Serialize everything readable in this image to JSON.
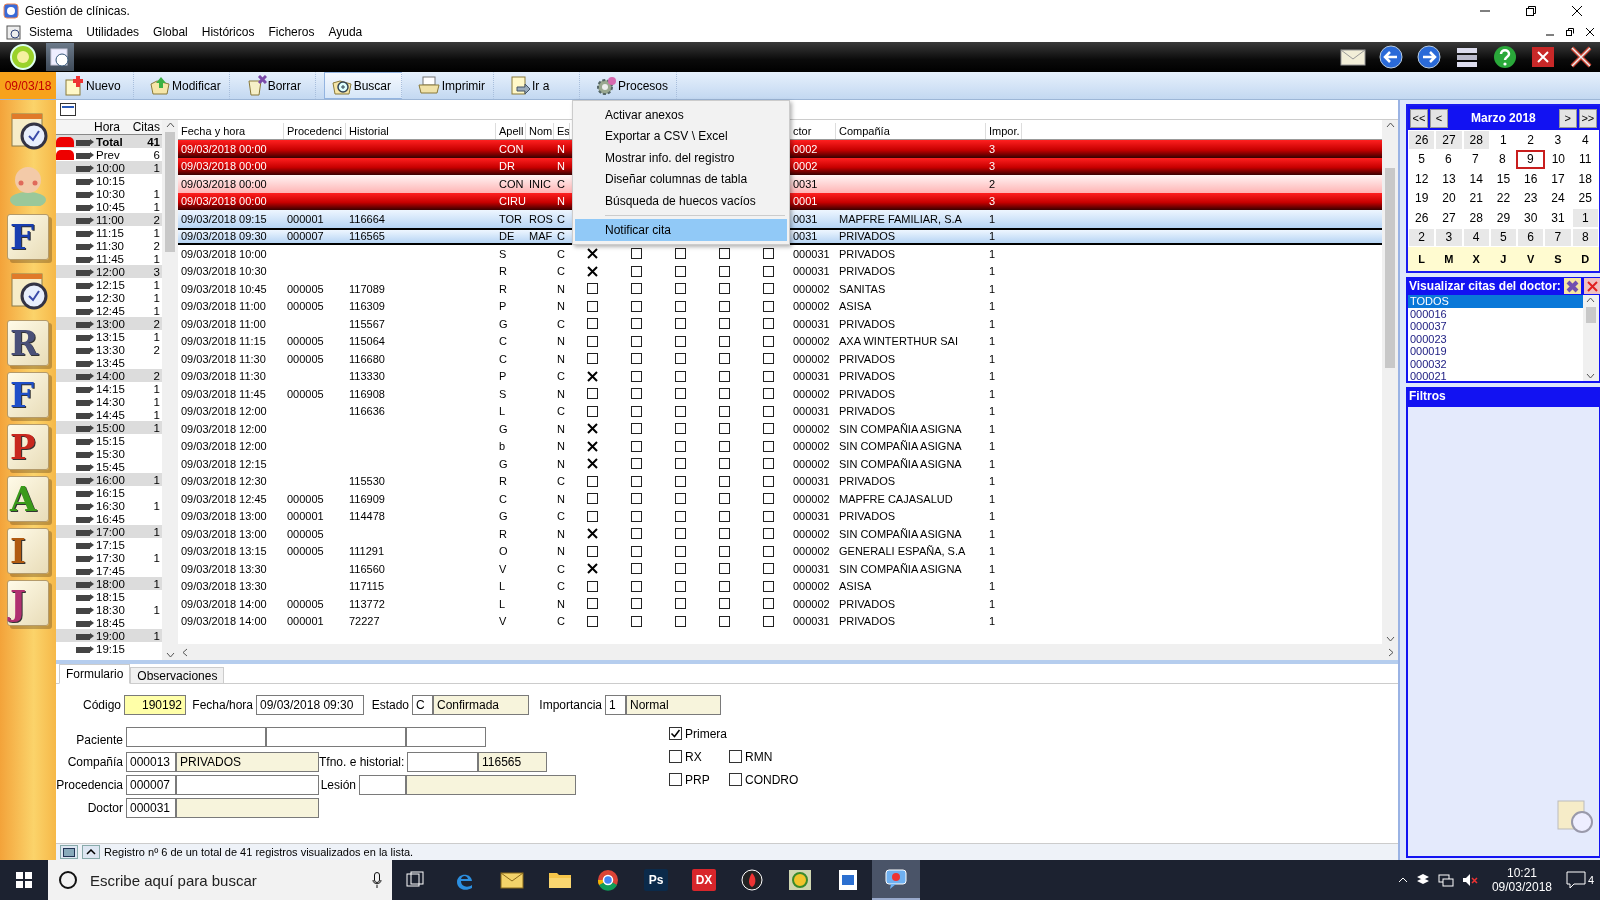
{
  "window": {
    "title": "Gestión de clínicas."
  },
  "menu": [
    "Sistema",
    "Utilidades",
    "Global",
    "Históricos",
    "Ficheros",
    "Ayuda"
  ],
  "toolbar": {
    "date": "09/03/18",
    "buttons": [
      {
        "label": "Nuevo",
        "selected": false
      },
      {
        "label": "Modificar",
        "selected": false
      },
      {
        "label": "Borrar",
        "selected": false
      },
      {
        "label": "Buscar",
        "selected": true
      },
      {
        "label": "Imprimir",
        "selected": false
      },
      {
        "label": "Ir a",
        "selected": false
      },
      {
        "label": "Procesos",
        "selected": false
      }
    ]
  },
  "sidebar": [
    {
      "kind": "calendar"
    },
    {
      "kind": "person"
    },
    {
      "kind": "letter",
      "label": "F",
      "color": "#1a3fb0"
    },
    {
      "kind": "calendar"
    },
    {
      "kind": "letter",
      "label": "R",
      "color": "#4a5078"
    },
    {
      "kind": "letter",
      "label": "F",
      "color": "#1f4fc8"
    },
    {
      "kind": "letter",
      "label": "P",
      "color": "#c8281e"
    },
    {
      "kind": "letter",
      "label": "A",
      "color": "#3a9a1a"
    },
    {
      "kind": "letter",
      "label": "I",
      "color": "#b05a10"
    },
    {
      "kind": "letter",
      "label": "J",
      "color": "#b03070"
    }
  ],
  "slots": {
    "columns": [
      "Hora",
      "Citas"
    ],
    "rows": [
      {
        "kind": "total",
        "hora": "Total",
        "citas": "41",
        "flag": true,
        "shaded": true
      },
      {
        "kind": "slot",
        "hora": "Prev",
        "citas": "6",
        "flag": true,
        "shaded": false
      },
      {
        "kind": "slot",
        "hora": "10:00",
        "citas": "1",
        "flag": false,
        "shaded": true
      },
      {
        "kind": "slot",
        "hora": "10:15",
        "flag": false,
        "shaded": false
      },
      {
        "kind": "slot",
        "hora": "10:30",
        "citas": "1",
        "flag": false,
        "shaded": false
      },
      {
        "kind": "slot",
        "hora": "10:45",
        "citas": "1",
        "flag": false,
        "shaded": false
      },
      {
        "kind": "slot",
        "hora": "11:00",
        "citas": "2",
        "flag": false,
        "shaded": true
      },
      {
        "kind": "slot",
        "hora": "11:15",
        "citas": "1",
        "flag": false,
        "shaded": false
      },
      {
        "kind": "slot",
        "hora": "11:30",
        "citas": "2",
        "flag": false,
        "shaded": false
      },
      {
        "kind": "slot",
        "hora": "11:45",
        "citas": "1",
        "flag": false,
        "shaded": false
      },
      {
        "kind": "slot",
        "hora": "12:00",
        "citas": "3",
        "flag": false,
        "shaded": true
      },
      {
        "kind": "slot",
        "hora": "12:15",
        "citas": "1",
        "flag": false,
        "shaded": false
      },
      {
        "kind": "slot",
        "hora": "12:30",
        "citas": "1",
        "flag": false,
        "shaded": false
      },
      {
        "kind": "slot",
        "hora": "12:45",
        "citas": "1",
        "flag": false,
        "shaded": false
      },
      {
        "kind": "slot",
        "hora": "13:00",
        "citas": "2",
        "flag": false,
        "shaded": true
      },
      {
        "kind": "slot",
        "hora": "13:15",
        "citas": "1",
        "flag": false,
        "shaded": false
      },
      {
        "kind": "slot",
        "hora": "13:30",
        "citas": "2",
        "flag": false,
        "shaded": false
      },
      {
        "kind": "slot",
        "hora": "13:45",
        "flag": false,
        "shaded": false
      },
      {
        "kind": "slot",
        "hora": "14:00",
        "citas": "2",
        "flag": false,
        "shaded": true
      },
      {
        "kind": "slot",
        "hora": "14:15",
        "citas": "1",
        "flag": false,
        "shaded": false
      },
      {
        "kind": "slot",
        "hora": "14:30",
        "citas": "1",
        "flag": false,
        "shaded": false
      },
      {
        "kind": "slot",
        "hora": "14:45",
        "citas": "1",
        "flag": false,
        "shaded": false
      },
      {
        "kind": "slot",
        "hora": "15:00",
        "citas": "1",
        "flag": false,
        "shaded": true
      },
      {
        "kind": "slot",
        "hora": "15:15",
        "flag": false,
        "shaded": false
      },
      {
        "kind": "slot",
        "hora": "15:30",
        "flag": false,
        "shaded": false
      },
      {
        "kind": "slot",
        "hora": "15:45",
        "flag": false,
        "shaded": false
      },
      {
        "kind": "slot",
        "hora": "16:00",
        "citas": "1",
        "flag": false,
        "shaded": true
      },
      {
        "kind": "slot",
        "hora": "16:15",
        "flag": false,
        "shaded": false
      },
      {
        "kind": "slot",
        "hora": "16:30",
        "citas": "1",
        "flag": false,
        "shaded": false
      },
      {
        "kind": "slot",
        "hora": "16:45",
        "flag": false,
        "shaded": false
      },
      {
        "kind": "slot",
        "hora": "17:00",
        "citas": "1",
        "flag": false,
        "shaded": true
      },
      {
        "kind": "slot",
        "hora": "17:15",
        "flag": false,
        "shaded": false
      },
      {
        "kind": "slot",
        "hora": "17:30",
        "citas": "1",
        "flag": false,
        "shaded": false
      },
      {
        "kind": "slot",
        "hora": "17:45",
        "flag": false,
        "shaded": false
      },
      {
        "kind": "slot",
        "hora": "18:00",
        "citas": "1",
        "flag": false,
        "shaded": true
      },
      {
        "kind": "slot",
        "hora": "18:15",
        "flag": false,
        "shaded": false
      },
      {
        "kind": "slot",
        "hora": "18:30",
        "citas": "1",
        "flag": false,
        "shaded": false
      },
      {
        "kind": "slot",
        "hora": "18:45",
        "flag": false,
        "shaded": false
      },
      {
        "kind": "slot",
        "hora": "19:00",
        "citas": "1",
        "flag": false,
        "shaded": true
      },
      {
        "kind": "slot",
        "hora": "19:15",
        "flag": false,
        "shaded": false
      }
    ]
  },
  "table": {
    "columns": [
      "Fecha y hora",
      "Procedenci",
      "Historial",
      "Apell",
      "Nom",
      "Es",
      "ctor",
      "Compañía",
      "Impor."
    ],
    "rows": [
      {
        "kind": "alert",
        "selected": false,
        "date_time": "09/03/2018 00:00",
        "surname": "CON",
        "status": "N",
        "doctor": "0002",
        "weight": "3"
      },
      {
        "kind": "alert",
        "selected": false,
        "date_time": "09/03/2018 00:00",
        "surname": "DR",
        "status": "N",
        "doctor": "0002",
        "weight": "3"
      },
      {
        "kind": "warning",
        "selected": false,
        "date_time": "09/03/2018 00:00",
        "surname": "CON",
        "name": "INIC",
        "status": "C",
        "doctor": "0031",
        "weight": "2"
      },
      {
        "kind": "alert",
        "selected": false,
        "date_time": "09/03/2018 00:00",
        "surname": "CIRU",
        "status": "N",
        "doctor": "0001",
        "weight": "3"
      },
      {
        "kind": "marked",
        "selected": false,
        "date_time": "09/03/2018 09:15",
        "origin": "000001",
        "record": "116664",
        "surname": "TOR",
        "name": "ROS",
        "status": "C",
        "doctor": "0031",
        "company": "MAPFRE FAMILIAR, S.A",
        "weight": "1"
      },
      {
        "kind": "marked",
        "selected": true,
        "date_time": "09/03/2018 09:30",
        "origin": "000007",
        "record": "116565",
        "surname": "DE",
        "name": "MAF",
        "status": "C",
        "doctor": "0031",
        "company": "PRIVADOS",
        "weight": "1"
      },
      {
        "kind": "plain",
        "selected": false,
        "date_time": "09/03/2018 10:00",
        "surname": "S",
        "status": "C",
        "checks": [
          true,
          false,
          false,
          false,
          false
        ],
        "doctor": "000031",
        "company": "PRIVADOS",
        "weight": "1"
      },
      {
        "kind": "plain",
        "selected": false,
        "date_time": "09/03/2018 10:30",
        "surname": "R",
        "status": "C",
        "checks": [
          true,
          false,
          false,
          false,
          false
        ],
        "doctor": "000031",
        "company": "PRIVADOS",
        "weight": "1"
      },
      {
        "kind": "plain",
        "selected": false,
        "date_time": "09/03/2018 10:45",
        "origin": "000005",
        "record": "117089",
        "surname": "R",
        "status": "N",
        "checks": [
          false,
          false,
          false,
          false,
          false
        ],
        "doctor": "000002",
        "company": "SANITAS",
        "weight": "1"
      },
      {
        "kind": "plain",
        "selected": false,
        "date_time": "09/03/2018 11:00",
        "origin": "000005",
        "record": "116309",
        "surname": "P",
        "status": "N",
        "checks": [
          false,
          false,
          false,
          false,
          false
        ],
        "doctor": "000002",
        "company": "ASISA",
        "weight": "1"
      },
      {
        "kind": "plain",
        "selected": false,
        "date_time": "09/03/2018 11:00",
        "record": "115567",
        "surname": "G",
        "status": "C",
        "checks": [
          false,
          false,
          false,
          false,
          false
        ],
        "doctor": "000031",
        "company": "PRIVADOS",
        "weight": "1"
      },
      {
        "kind": "plain",
        "selected": false,
        "date_time": "09/03/2018 11:15",
        "origin": "000005",
        "record": "115064",
        "surname": "C",
        "status": "N",
        "checks": [
          false,
          false,
          false,
          false,
          false
        ],
        "doctor": "000002",
        "company": "AXA WINTERTHUR SAI",
        "weight": "1"
      },
      {
        "kind": "plain",
        "selected": false,
        "date_time": "09/03/2018 11:30",
        "origin": "000005",
        "record": "116680",
        "surname": "C",
        "status": "N",
        "checks": [
          false,
          false,
          false,
          false,
          false
        ],
        "doctor": "000002",
        "company": "PRIVADOS",
        "weight": "1"
      },
      {
        "kind": "plain",
        "selected": false,
        "date_time": "09/03/2018 11:30",
        "record": "113330",
        "surname": "P",
        "status": "C",
        "checks": [
          true,
          false,
          false,
          false,
          false
        ],
        "doctor": "000031",
        "company": "PRIVADOS",
        "weight": "1"
      },
      {
        "kind": "plain",
        "selected": false,
        "date_time": "09/03/2018 11:45",
        "origin": "000005",
        "record": "116908",
        "surname": "S",
        "status": "N",
        "checks": [
          false,
          false,
          false,
          false,
          false
        ],
        "doctor": "000002",
        "company": "PRIVADOS",
        "weight": "1"
      },
      {
        "kind": "plain",
        "selected": false,
        "date_time": "09/03/2018 12:00",
        "record": "116636",
        "surname": "L",
        "status": "C",
        "checks": [
          false,
          false,
          false,
          false,
          false
        ],
        "doctor": "000031",
        "company": "PRIVADOS",
        "weight": "1"
      },
      {
        "kind": "plain",
        "selected": false,
        "date_time": "09/03/2018 12:00",
        "surname": "G",
        "status": "N",
        "checks": [
          true,
          false,
          false,
          false,
          false
        ],
        "doctor": "000002",
        "company": "SIN COMPAÑIA ASIGNA",
        "weight": "1"
      },
      {
        "kind": "plain",
        "selected": false,
        "date_time": "09/03/2018 12:00",
        "surname": "b",
        "status": "N",
        "checks": [
          true,
          false,
          false,
          false,
          false
        ],
        "doctor": "000002",
        "company": "SIN COMPAÑIA ASIGNA",
        "weight": "1"
      },
      {
        "kind": "plain",
        "selected": false,
        "date_time": "09/03/2018 12:15",
        "surname": "G",
        "status": "N",
        "checks": [
          true,
          false,
          false,
          false,
          false
        ],
        "doctor": "000002",
        "company": "SIN COMPAÑIA ASIGNA",
        "weight": "1"
      },
      {
        "kind": "plain",
        "selected": false,
        "date_time": "09/03/2018 12:30",
        "record": "115530",
        "surname": "R",
        "status": "C",
        "checks": [
          false,
          false,
          false,
          false,
          false
        ],
        "doctor": "000031",
        "company": "PRIVADOS",
        "weight": "1"
      },
      {
        "kind": "plain",
        "selected": false,
        "date_time": "09/03/2018 12:45",
        "origin": "000005",
        "record": "116909",
        "surname": "C",
        "status": "N",
        "checks": [
          false,
          false,
          false,
          false,
          false
        ],
        "doctor": "000002",
        "company": "MAPFRE CAJASALUD",
        "weight": "1"
      },
      {
        "kind": "plain",
        "selected": false,
        "date_time": "09/03/2018 13:00",
        "origin": "000001",
        "record": "114478",
        "surname": "G",
        "status": "C",
        "checks": [
          false,
          false,
          false,
          false,
          false
        ],
        "doctor": "000031",
        "company": "PRIVADOS",
        "weight": "1"
      },
      {
        "kind": "plain",
        "selected": false,
        "date_time": "09/03/2018 13:00",
        "origin": "000005",
        "surname": "R",
        "status": "N",
        "checks": [
          true,
          false,
          false,
          false,
          false
        ],
        "doctor": "000002",
        "company": "SIN COMPAÑIA ASIGNA",
        "weight": "1"
      },
      {
        "kind": "plain",
        "selected": false,
        "date_time": "09/03/2018 13:15",
        "origin": "000005",
        "record": "111291",
        "surname": "O",
        "status": "N",
        "checks": [
          false,
          false,
          false,
          false,
          false
        ],
        "doctor": "000002",
        "company": "GENERALI ESPAÑA, S.A",
        "weight": "1"
      },
      {
        "kind": "plain",
        "selected": false,
        "date_time": "09/03/2018 13:30",
        "record": "116560",
        "surname": "V",
        "status": "C",
        "checks": [
          true,
          false,
          false,
          false,
          false
        ],
        "doctor": "000031",
        "company": "SIN COMPAÑIA ASIGNA",
        "weight": "1"
      },
      {
        "kind": "plain",
        "selected": false,
        "date_time": "09/03/2018 13:30",
        "record": "117115",
        "surname": "L",
        "status": "C",
        "checks": [
          false,
          false,
          false,
          false,
          false
        ],
        "doctor": "000002",
        "company": "ASISA",
        "weight": "1"
      },
      {
        "kind": "plain",
        "selected": false,
        "date_time": "09/03/2018 14:00",
        "origin": "000005",
        "record": "113772",
        "surname": "L",
        "status": "N",
        "checks": [
          false,
          false,
          false,
          false,
          false
        ],
        "doctor": "000002",
        "company": "PRIVADOS",
        "weight": "1"
      },
      {
        "kind": "plain",
        "selected": false,
        "date_time": "09/03/2018 14:00",
        "origin": "000001",
        "record": "72227",
        "surname": "V",
        "status": "C",
        "checks": [
          false,
          false,
          false,
          false,
          false
        ],
        "doctor": "000031",
        "company": "PRIVADOS",
        "weight": "1"
      }
    ]
  },
  "context_menu": {
    "items": [
      {
        "label": "Activar anexos",
        "selected": false
      },
      {
        "label": "Exportar a CSV \\ Excel",
        "selected": false
      },
      {
        "label": "Mostrar info. del registro",
        "selected": false
      },
      {
        "label": "Diseñar columnas de tabla",
        "selected": false
      },
      {
        "label": "Búsqueda de huecos vacíos",
        "selected": false
      },
      {
        "label": "Notificar cita",
        "selected": true,
        "separated": true
      }
    ]
  },
  "form": {
    "tabs": [
      {
        "label": "Formulario",
        "selected": true
      },
      {
        "label": "Observaciones",
        "selected": false
      }
    ],
    "code": {
      "label": "Código",
      "value": "190192"
    },
    "datetime": {
      "label": "Fecha/hora",
      "value": "09/03/2018 09:30"
    },
    "state": {
      "label": "Estado",
      "code": "C",
      "value": "Confirmada"
    },
    "importance": {
      "label": "Importancia",
      "code": "1",
      "value": "Normal"
    },
    "patient": {
      "label": "Paciente"
    },
    "company": {
      "label": "Compañía",
      "code": "000013",
      "value": "PRIVADOS"
    },
    "phone": {
      "label": "Tfno. e historial:",
      "value": "116565"
    },
    "origin": {
      "label": "Procedencia",
      "code": "000007"
    },
    "injury": {
      "label": "Lesión"
    },
    "doctor": {
      "label": "Doctor",
      "code": "000031"
    },
    "checks": [
      [
        {
          "label": "Primera",
          "checked": true
        }
      ],
      [
        {
          "label": "RX",
          "checked": false
        },
        {
          "label": "RMN",
          "checked": false
        }
      ],
      [
        {
          "label": "PRP",
          "checked": false
        },
        {
          "label": "CONDRO",
          "checked": false
        }
      ]
    ]
  },
  "status_bar": "Registro nº 6 de un total de 41 registros visualizados en la lista.",
  "calendar": {
    "title": "Marzo 2018",
    "nav_left": [
      "<<",
      "<"
    ],
    "nav_right": [
      ">",
      ">>"
    ],
    "weekdays": [
      "L",
      "M",
      "X",
      "J",
      "V",
      "S",
      "D"
    ],
    "weeks": [
      [
        {
          "day": "26",
          "outside": true,
          "selected": false
        },
        {
          "day": "27",
          "outside": true,
          "selected": false
        },
        {
          "day": "28",
          "outside": true,
          "selected": false
        },
        {
          "day": "1",
          "outside": false,
          "selected": false
        },
        {
          "day": "2",
          "outside": false,
          "selected": false
        },
        {
          "day": "3",
          "outside": false,
          "selected": false
        },
        {
          "day": "4",
          "outside": false,
          "selected": false
        }
      ],
      [
        {
          "day": "5",
          "outside": false,
          "selected": false
        },
        {
          "day": "6",
          "outside": false,
          "selected": false
        },
        {
          "day": "7",
          "outside": false,
          "selected": false
        },
        {
          "day": "8",
          "outside": false,
          "selected": false
        },
        {
          "day": "9",
          "outside": false,
          "selected": true
        },
        {
          "day": "10",
          "outside": false,
          "selected": false
        },
        {
          "day": "11",
          "outside": false,
          "selected": false
        }
      ],
      [
        {
          "day": "12",
          "outside": false,
          "selected": false
        },
        {
          "day": "13",
          "outside": false,
          "selected": false
        },
        {
          "day": "14",
          "outside": false,
          "selected": false
        },
        {
          "day": "15",
          "outside": false,
          "selected": false
        },
        {
          "day": "16",
          "outside": false,
          "selected": false
        },
        {
          "day": "17",
          "outside": false,
          "selected": false
        },
        {
          "day": "18",
          "outside": false,
          "selected": false
        }
      ],
      [
        {
          "day": "19",
          "outside": false,
          "selected": false
        },
        {
          "day": "20",
          "outside": false,
          "selected": false
        },
        {
          "day": "21",
          "outside": false,
          "selected": false
        },
        {
          "day": "22",
          "outside": false,
          "selected": false
        },
        {
          "day": "23",
          "outside": false,
          "selected": false
        },
        {
          "day": "24",
          "outside": false,
          "selected": false
        },
        {
          "day": "25",
          "outside": false,
          "selected": false
        }
      ],
      [
        {
          "day": "26",
          "outside": false,
          "selected": false
        },
        {
          "day": "27",
          "outside": false,
          "selected": false
        },
        {
          "day": "28",
          "outside": false,
          "selected": false
        },
        {
          "day": "29",
          "outside": false,
          "selected": false
        },
        {
          "day": "30",
          "outside": false,
          "selected": false
        },
        {
          "day": "31",
          "outside": false,
          "selected": false
        },
        {
          "day": "1",
          "outside": true,
          "selected": false
        }
      ],
      [
        {
          "day": "2",
          "outside": true,
          "selected": false
        },
        {
          "day": "3",
          "outside": true,
          "selected": false
        },
        {
          "day": "4",
          "outside": true,
          "selected": false
        },
        {
          "day": "5",
          "outside": true,
          "selected": false
        },
        {
          "day": "6",
          "outside": true,
          "selected": false
        },
        {
          "day": "7",
          "outside": true,
          "selected": false
        },
        {
          "day": "8",
          "outside": true,
          "selected": false
        }
      ]
    ]
  },
  "doctor_filter": {
    "title": "Visualizar citas del doctor:",
    "items": [
      {
        "label": "TODOS",
        "selected": true
      },
      {
        "label": "000016",
        "selected": false
      },
      {
        "label": "000037",
        "selected": false
      },
      {
        "label": "000023",
        "selected": false
      },
      {
        "label": "000019",
        "selected": false
      },
      {
        "label": "000032",
        "selected": false
      },
      {
        "label": "000021",
        "selected": false
      }
    ]
  },
  "filters": {
    "title": "Filtros"
  },
  "taskbar": {
    "search": {
      "placeholder": "Escribe aquí para buscar"
    },
    "apps": [
      {
        "kind": "taskview",
        "active": false
      },
      {
        "kind": "browser",
        "active": false
      },
      {
        "kind": "mail",
        "active": false
      },
      {
        "kind": "folder",
        "active": false
      },
      {
        "kind": "chrome",
        "active": false
      },
      {
        "kind": "badge",
        "label": "Ps",
        "color": "#0b2a4a",
        "active": false
      },
      {
        "kind": "badge",
        "label": "DX",
        "color": "#d8262b",
        "active": false
      },
      {
        "kind": "flame",
        "active": false
      },
      {
        "kind": "orb",
        "active": false
      },
      {
        "kind": "picture",
        "active": false
      },
      {
        "kind": "chat",
        "active": true
      }
    ],
    "time": "10:21",
    "date": "09/03/2018",
    "notifications": "4"
  }
}
